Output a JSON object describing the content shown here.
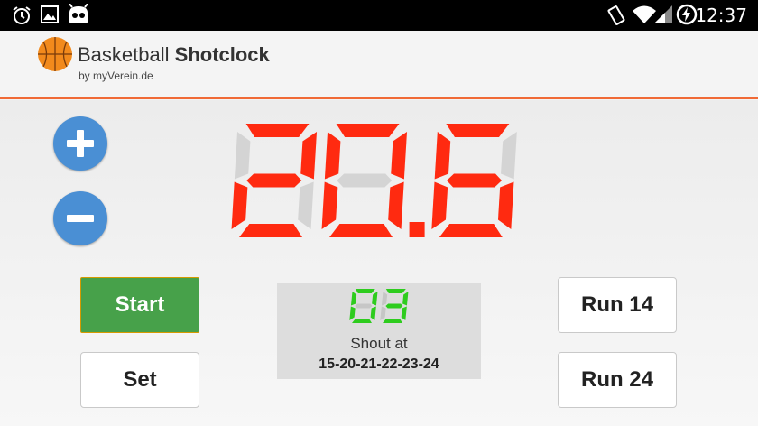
{
  "status_bar": {
    "time": "12:37",
    "icons": [
      "alarm-icon",
      "image-icon",
      "android-icon",
      "rotate-icon",
      "wifi-icon",
      "signal-icon",
      "battery-charging-icon"
    ]
  },
  "app": {
    "logo_icon": "basketball-icon",
    "title_regular": "Basketball",
    "title_bold": "Shotclock",
    "subtitle": "by myVerein.de"
  },
  "clock": {
    "display": "20.6",
    "active_color": "#ff2a10",
    "inactive_color": "#d4d4d4"
  },
  "controls": {
    "increment_icon": "plus-icon",
    "decrement_icon": "minus-icon",
    "start_label": "Start",
    "set_label": "Set",
    "run14_label": "Run 14",
    "run24_label": "Run 24"
  },
  "shout": {
    "value": "03",
    "label": "Shout at",
    "sequence": "15-20-21-22-23-24",
    "active_color": "#2ecc1e",
    "inactive_color": "#c6c6c6"
  },
  "colors": {
    "accent": "#f06a36",
    "start_button": "#47a14a",
    "round_buttons": "#4a8fd4"
  }
}
